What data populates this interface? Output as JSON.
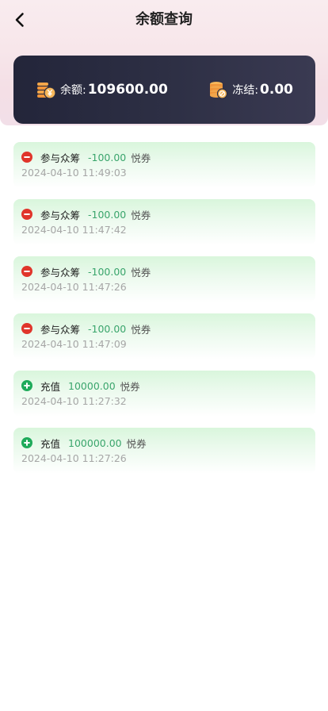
{
  "header": {
    "title": "余额查询"
  },
  "balance_card": {
    "balance_label": "余额:",
    "balance_value": "109600.00",
    "frozen_label": "冻结:",
    "frozen_value": "0.00"
  },
  "colors": {
    "amount_green": "#3aa56c",
    "minus_red": "#e0352b",
    "plus_green": "#1eaa5a",
    "card_dark": "#23253a"
  },
  "records": [
    {
      "type": "minus",
      "icon": "minus-circle-icon",
      "title": "参与众筹",
      "amount": "-100.00",
      "unit": "悦券",
      "time": "2024-04-10 11:49:03"
    },
    {
      "type": "minus",
      "icon": "minus-circle-icon",
      "title": "参与众筹",
      "amount": "-100.00",
      "unit": "悦券",
      "time": "2024-04-10 11:47:42"
    },
    {
      "type": "minus",
      "icon": "minus-circle-icon",
      "title": "参与众筹",
      "amount": "-100.00",
      "unit": "悦券",
      "time": "2024-04-10 11:47:26"
    },
    {
      "type": "minus",
      "icon": "minus-circle-icon",
      "title": "参与众筹",
      "amount": "-100.00",
      "unit": "悦券",
      "time": "2024-04-10 11:47:09"
    },
    {
      "type": "plus",
      "icon": "plus-circle-icon",
      "title": "充值",
      "amount": "10000.00",
      "unit": "悦券",
      "time": "2024-04-10 11:27:32"
    },
    {
      "type": "plus",
      "icon": "plus-circle-icon",
      "title": "充值",
      "amount": "100000.00",
      "unit": "悦券",
      "time": "2024-04-10 11:27:26"
    }
  ]
}
